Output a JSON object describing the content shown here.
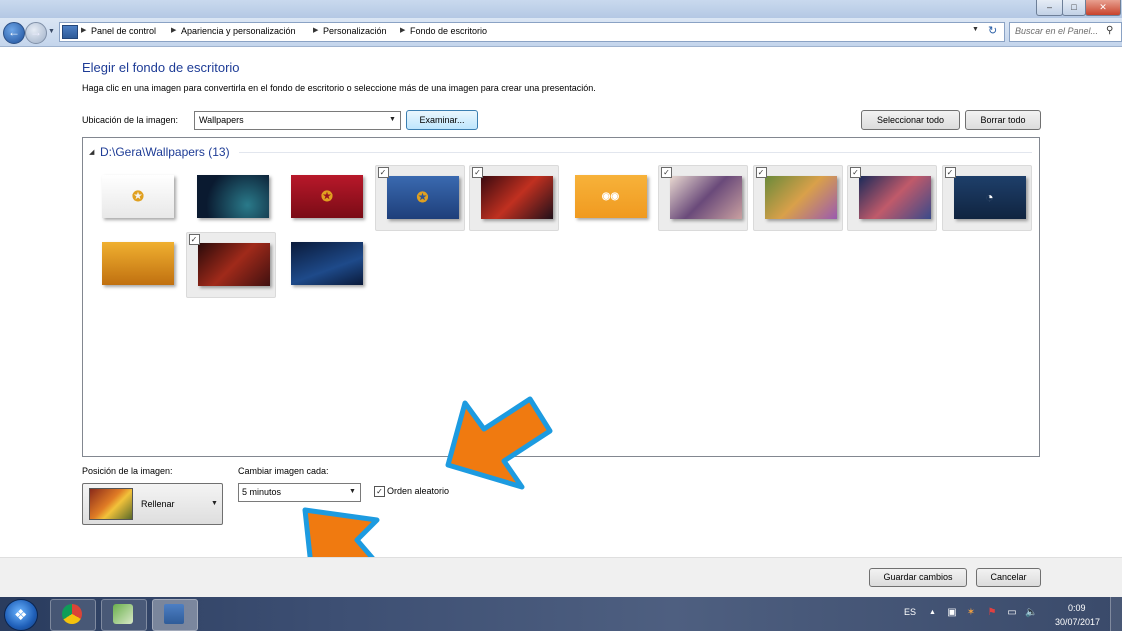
{
  "window": {
    "minimize": "–",
    "maximize": "□",
    "close": "✕"
  },
  "nav": {
    "breadcrumbs": [
      "Panel de control",
      "Apariencia y personalización",
      "Personalización",
      "Fondo de escritorio"
    ],
    "search_placeholder": "Buscar en el Panel..."
  },
  "main": {
    "title": "Elegir el fondo de escritorio",
    "description": "Haga clic en una imagen para convertirla en el fondo de escritorio o seleccione más de una imagen para crear una presentación.",
    "location_label": "Ubicación de la imagen:",
    "location_value": "Wallpapers",
    "browse_label": "Examinar...",
    "select_all_label": "Seleccionar todo",
    "clear_all_label": "Borrar todo"
  },
  "gallery": {
    "group_title": "D:\\Gera\\Wallpapers (13)",
    "items": [
      {
        "selected": false,
        "bg": "linear-gradient(#ffffff,#e8e8e8)",
        "icon": "logo-badge"
      },
      {
        "selected": false,
        "bg": "radial-gradient(circle at 70% 70%,#2a7a8a,#0a1a30 70%)",
        "icon": ""
      },
      {
        "selected": false,
        "bg": "linear-gradient(#b8182a,#7a0c16)",
        "icon": "logo-badge"
      },
      {
        "selected": true,
        "bg": "linear-gradient(#3a6ab0,#1e3f7a)",
        "icon": "logo-badge"
      },
      {
        "selected": true,
        "bg": "linear-gradient(135deg,#3a0a10,#c03020 50%,#20101a)",
        "icon": ""
      },
      {
        "selected": false,
        "bg": "linear-gradient(#f7b23a,#f09a20)",
        "icon": "face"
      },
      {
        "selected": true,
        "bg": "linear-gradient(135deg,#e9d9d0,#6a4a7a 50%,#c9a0a0)",
        "icon": ""
      },
      {
        "selected": true,
        "bg": "linear-gradient(135deg,#6a8a3a,#d9a04a 50%,#9a5ab0)",
        "icon": ""
      },
      {
        "selected": true,
        "bg": "linear-gradient(135deg,#1a2a5a,#c05a6a 50%,#3a4a8a)",
        "icon": ""
      },
      {
        "selected": true,
        "bg": "linear-gradient(#1e3f6a,#102440)",
        "icon": "ring"
      },
      {
        "selected": false,
        "bg": "linear-gradient(#f0b030,#c07010)",
        "icon": ""
      },
      {
        "selected": true,
        "bg": "linear-gradient(135deg,#2a0a0a,#a02a1a 50%,#401010)",
        "icon": ""
      },
      {
        "selected": false,
        "bg": "linear-gradient(160deg,#0a1a3a,#1e4a8a 60%,#0a1a3a)",
        "icon": ""
      }
    ]
  },
  "bottom": {
    "position_label": "Posición de la imagen:",
    "position_value": "Rellenar",
    "interval_label": "Cambiar imagen cada:",
    "interval_value": "5 minutos",
    "shuffle_label": "Orden aleatorio",
    "shuffle_checked": true
  },
  "footer": {
    "save_label": "Guardar cambios",
    "cancel_label": "Cancelar"
  },
  "taskbar": {
    "language": "ES",
    "time": "0:09",
    "date": "30/07/2017"
  }
}
